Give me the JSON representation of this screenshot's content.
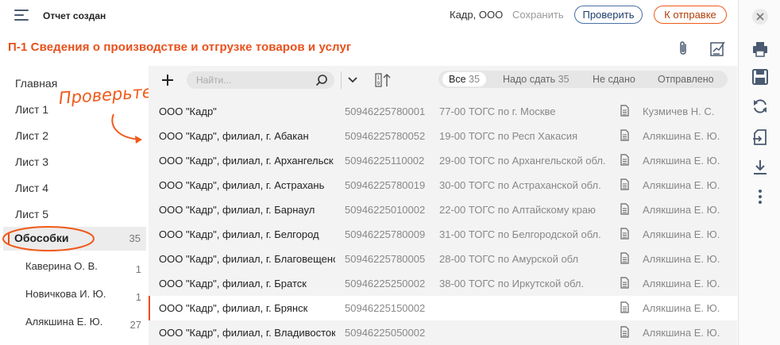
{
  "header": {
    "report_status": "Отчет создан",
    "org_name": "Кадр, ООО",
    "save_label": "Сохранить",
    "check_label": "Проверить",
    "send_label": "К отправке"
  },
  "form": {
    "title": "П-1 Сведения о производстве и отгрузке товаров и услуг"
  },
  "sidebar": {
    "items": [
      {
        "label": "Главная"
      },
      {
        "label": "Лист 1"
      },
      {
        "label": "Лист 2"
      },
      {
        "label": "Лист 3"
      },
      {
        "label": "Лист 4"
      },
      {
        "label": "Лист 5"
      }
    ],
    "active": {
      "label": "Обособки",
      "count": "35"
    },
    "subitems": [
      {
        "label": "Каверина О. В.",
        "count": "1"
      },
      {
        "label": "Новичкова И. Ю.",
        "count": "1"
      },
      {
        "label": "Алякшина Е. Ю.",
        "count": "27"
      }
    ]
  },
  "annotation": {
    "text": "Проверьте"
  },
  "toolbar": {
    "search_placeholder": "Найти...",
    "filters": [
      {
        "label": "Все",
        "count": "35",
        "active": true
      },
      {
        "label": "Надо сдать",
        "count": "35",
        "active": false
      },
      {
        "label": "Не сдано",
        "count": "",
        "active": false
      },
      {
        "label": "Отправлено",
        "count": "",
        "active": false
      }
    ]
  },
  "rows": [
    {
      "name": "ООО \"Кадр\"",
      "code": "50946225780001",
      "tofk": "77-00 ТОГС по г. Москве",
      "person": "Кузмичев Н. С.",
      "doc": true
    },
    {
      "name": "ООО \"Кадр\", филиал, г. Абакан",
      "code": "50946225780052",
      "tofk": "19-00 ТОГС по Респ Хакасия",
      "person": "Алякшина Е. Ю.",
      "doc": true
    },
    {
      "name": "ООО \"Кадр\", филиал, г. Архангельск",
      "code": "50946225110002",
      "tofk": "29-00 ТОГС по Архангельской обл.",
      "person": "Алякшина Е. Ю.",
      "doc": true
    },
    {
      "name": "ООО \"Кадр\", филиал, г. Астрахань",
      "code": "50946225780019",
      "tofk": "30-00 ТОГС по Астраханской обл.",
      "person": "Алякшина Е. Ю.",
      "doc": true
    },
    {
      "name": "ООО \"Кадр\", филиал, г. Барнаул",
      "code": "50946225010002",
      "tofk": "22-00 ТОГС по Алтайскому краю",
      "person": "Алякшина Е. Ю.",
      "doc": true
    },
    {
      "name": "ООО \"Кадр\", филиал, г. Белгород",
      "code": "50946225780009",
      "tofk": "31-00 ТОГС по Белгородской обл.",
      "person": "Алякшина Е. Ю.",
      "doc": true
    },
    {
      "name": "ООО \"Кадр\", филиал, г. Благовещенск",
      "code": "50946225780005",
      "tofk": "28-00 ТОГС по Амурской обл",
      "person": "Алякшина Е. Ю.",
      "doc": true
    },
    {
      "name": "ООО \"Кадр\", филиал, г. Братск",
      "code": "50946225250002",
      "tofk": "38-00 ТОГС по Иркутской обл.",
      "person": "Алякшина Е. Ю.",
      "doc": true
    },
    {
      "name": "ООО \"Кадр\", филиал, г. Брянск",
      "code": "50946225150002",
      "tofk": "",
      "person": "Алякшина Е. Ю.",
      "doc": true,
      "highlight": true
    },
    {
      "name": "ООО \"Кадр\", филиал, г. Владивосток",
      "code": "50946225050002",
      "tofk": "",
      "person": "Алякшина Е. Ю.",
      "doc": true
    }
  ],
  "colors": {
    "accent": "#e8501c",
    "primary": "#4a6fa5",
    "icon": "#4a5a70"
  },
  "icons": {
    "right_toolbar": [
      "close-icon",
      "printer-icon",
      "save-icon",
      "refresh-icon",
      "import-icon",
      "download-icon",
      "more-icon"
    ]
  }
}
